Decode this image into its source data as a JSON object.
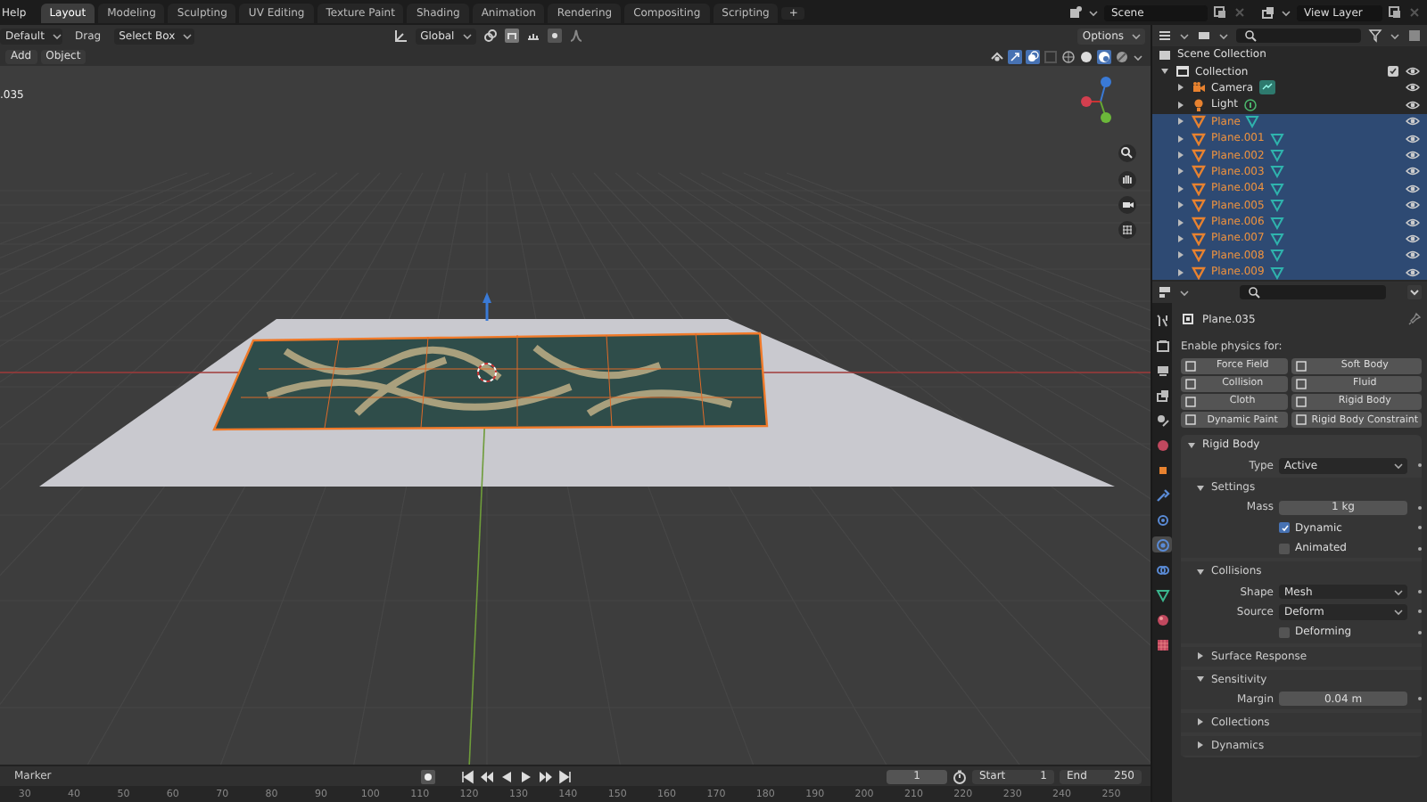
{
  "menu": {
    "label": "Help"
  },
  "workspace_tabs": [
    {
      "label": "Layout",
      "selected": true
    },
    {
      "label": "Modeling",
      "selected": false
    },
    {
      "label": "Sculpting",
      "selected": false
    },
    {
      "label": "UV Editing",
      "selected": false
    },
    {
      "label": "Texture Paint",
      "selected": false
    },
    {
      "label": "Shading",
      "selected": false
    },
    {
      "label": "Animation",
      "selected": false
    },
    {
      "label": "Rendering",
      "selected": false
    },
    {
      "label": "Compositing",
      "selected": false
    },
    {
      "label": "Scripting",
      "selected": false
    }
  ],
  "add_tab": "+",
  "scene": {
    "value": "Scene"
  },
  "view_layer": {
    "value": "View Layer"
  },
  "tool_header": {
    "mode": "Default",
    "drag_label": "Drag",
    "select_mode": "Select Box",
    "orientation": "Global",
    "options": "Options"
  },
  "viewport": {
    "menus": [
      "Add",
      "Object"
    ],
    "overlay_text": ".035"
  },
  "outliner": {
    "root": "Scene Collection",
    "items": [
      {
        "name": "Collection",
        "kind": "collection",
        "expanded": true,
        "selected": false,
        "children": [
          {
            "name": "Camera",
            "kind": "camera",
            "expanded": false,
            "selected": false
          },
          {
            "name": "Light",
            "kind": "light",
            "expanded": false,
            "selected": false
          },
          {
            "name": "Plane",
            "kind": "mesh",
            "expanded": false,
            "selected": true
          },
          {
            "name": "Plane.001",
            "kind": "mesh",
            "expanded": false,
            "selected": true
          },
          {
            "name": "Plane.002",
            "kind": "mesh",
            "expanded": false,
            "selected": true
          },
          {
            "name": "Plane.003",
            "kind": "mesh",
            "expanded": false,
            "selected": true
          },
          {
            "name": "Plane.004",
            "kind": "mesh",
            "expanded": false,
            "selected": true
          },
          {
            "name": "Plane.005",
            "kind": "mesh",
            "expanded": false,
            "selected": true
          },
          {
            "name": "Plane.006",
            "kind": "mesh",
            "expanded": false,
            "selected": true
          },
          {
            "name": "Plane.007",
            "kind": "mesh",
            "expanded": false,
            "selected": true
          },
          {
            "name": "Plane.008",
            "kind": "mesh",
            "expanded": false,
            "selected": true
          },
          {
            "name": "Plane.009",
            "kind": "mesh",
            "expanded": false,
            "selected": true
          }
        ]
      }
    ]
  },
  "properties": {
    "tabs": [
      {
        "kind": "tool",
        "selected": false
      },
      {
        "kind": "render",
        "selected": false
      },
      {
        "kind": "output",
        "selected": false
      },
      {
        "kind": "view_layer",
        "selected": false
      },
      {
        "kind": "scene",
        "selected": false
      },
      {
        "kind": "world",
        "selected": false
      },
      {
        "kind": "object",
        "selected": false
      },
      {
        "kind": "modifiers",
        "selected": false
      },
      {
        "kind": "particles",
        "selected": false
      },
      {
        "kind": "physics",
        "selected": true
      },
      {
        "kind": "constraints",
        "selected": false
      },
      {
        "kind": "data",
        "selected": false
      },
      {
        "kind": "material",
        "selected": false
      },
      {
        "kind": "texture",
        "selected": false
      }
    ],
    "object_name": "Plane.035",
    "physics_heading": "Enable physics for:",
    "physics_buttons": [
      "Force Field",
      "Soft Body",
      "Collision",
      "Fluid",
      "Cloth",
      "Rigid Body",
      "Dynamic Paint",
      "Rigid Body Constraint"
    ],
    "panel": {
      "title": "Rigid Body",
      "expanded": true,
      "rows": [
        {
          "kind": "dropdown",
          "label": "Type",
          "value": "Active"
        }
      ],
      "subpanels": [
        {
          "title": "Settings",
          "expanded": true,
          "rows": [
            {
              "kind": "number",
              "label": "Mass",
              "value": "1 kg"
            },
            {
              "kind": "checkbox",
              "label": "Dynamic",
              "checked": true
            },
            {
              "kind": "checkbox",
              "label": "Animated",
              "checked": false
            }
          ]
        },
        {
          "title": "Collisions",
          "expanded": true,
          "rows": [
            {
              "kind": "dropdown",
              "label": "Shape",
              "value": "Mesh"
            },
            {
              "kind": "dropdown",
              "label": "Source",
              "value": "Deform"
            },
            {
              "kind": "checkbox",
              "label": "Deforming",
              "checked": false
            }
          ]
        },
        {
          "title": "Surface Response",
          "expanded": false
        },
        {
          "title": "Sensitivity",
          "expanded": true,
          "rows": [
            {
              "kind": "number",
              "label": "Margin",
              "value": "0.04 m"
            }
          ]
        },
        {
          "title": "Collections",
          "expanded": false
        },
        {
          "title": "Dynamics",
          "expanded": false
        }
      ]
    }
  },
  "timeline": {
    "menu": "Marker",
    "current_frame": "1",
    "start_label": "Start",
    "start": "1",
    "end_label": "End",
    "end": "250",
    "ruler": [
      "30",
      "40",
      "50",
      "60",
      "70",
      "80",
      "90",
      "100",
      "110",
      "120",
      "130",
      "140",
      "150",
      "160",
      "170",
      "180",
      "190",
      "200",
      "210",
      "220",
      "230",
      "240",
      "250"
    ]
  }
}
